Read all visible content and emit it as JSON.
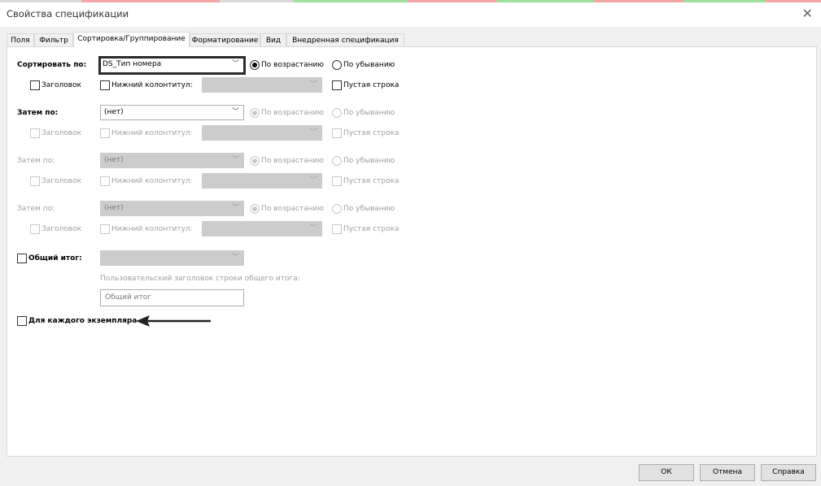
{
  "window": {
    "title": "Свойства спецификации",
    "close_glyph": "✕"
  },
  "tabs": [
    "Поля",
    "Фильтр",
    "Сортировка/Группирование",
    "Форматирование",
    "Вид",
    "Внедренная спецификация"
  ],
  "active_tab": "Сортировка/Группирование",
  "sort_rows": [
    {
      "label": "Сортировать по:",
      "value": "DS_Тип номера",
      "ascending": "По возрастанию",
      "descending": "По убыванию",
      "header": "Заголовок",
      "footer": "Нижний колонтитул:",
      "blank_line": "Пустая строка",
      "enabled": true
    },
    {
      "label": "Затем по:",
      "value": "(нет)",
      "ascending": "По возрастанию",
      "descending": "По убыванию",
      "header": "Заголовок",
      "footer": "Нижний колонтитул:",
      "blank_line": "Пустая строка",
      "enabled": true
    },
    {
      "label": "Затем по:",
      "value": "(нет)",
      "ascending": "По возрастанию",
      "descending": "По убыванию",
      "header": "Заголовок",
      "footer": "Нижний колонтитул:",
      "blank_line": "Пустая строка",
      "enabled": false
    },
    {
      "label": "Затем по:",
      "value": "(нет)",
      "ascending": "По возрастанию",
      "descending": "По убыванию",
      "header": "Заголовок",
      "footer": "Нижний колонтитул:",
      "blank_line": "Пустая строка",
      "enabled": false
    }
  ],
  "grand_total": {
    "label": "Общий итог:",
    "custom_title_label": "Пользовательский заголовок строки общего итога:",
    "custom_title_placeholder": "Общий итог"
  },
  "each_instance": {
    "label": "Для каждого экземпляра"
  },
  "buttons": {
    "ok": "ОК",
    "cancel": "Отмена",
    "help": "Справка"
  },
  "icons": {
    "dropdown": "chevron-down-icon",
    "close": "close-icon",
    "annotation": "arrow-left-icon"
  },
  "colors": {
    "top_strip": [
      "#d9d9d9",
      "#f4a6a6",
      "#d9d9d9",
      "#f4a6a6",
      "#9ee09e",
      "#f4a6a6",
      "#9ee09e",
      "#f4a6a6",
      "#9ee09e",
      "#f4a6a6"
    ]
  }
}
